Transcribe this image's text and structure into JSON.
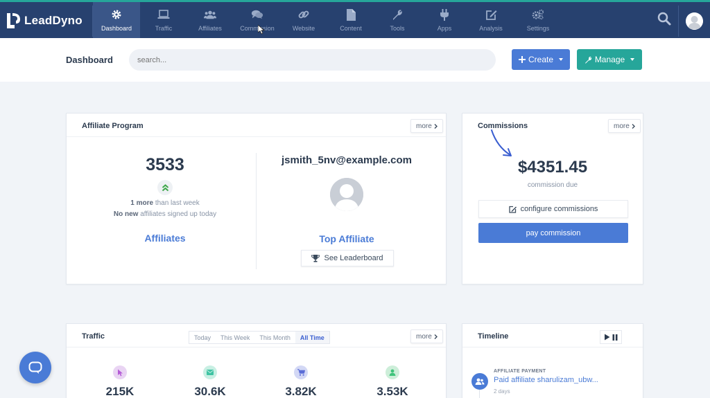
{
  "app": {
    "name": "LeadDyno"
  },
  "nav": {
    "items": [
      {
        "label": "Dashboard",
        "icon": "gear-icon",
        "active": true
      },
      {
        "label": "Traffic",
        "icon": "laptop-icon",
        "active": false
      },
      {
        "label": "Affiliates",
        "icon": "users-icon",
        "active": false
      },
      {
        "label": "Commission",
        "icon": "chat-bubbles-icon",
        "active": false
      },
      {
        "label": "Website",
        "icon": "link-icon",
        "active": false
      },
      {
        "label": "Content",
        "icon": "document-icon",
        "active": false
      },
      {
        "label": "Tools",
        "icon": "wrench-icon",
        "active": false
      },
      {
        "label": "Apps",
        "icon": "plug-icon",
        "active": false
      },
      {
        "label": "Analysis",
        "icon": "edit-square-icon",
        "active": false
      },
      {
        "label": "Settings",
        "icon": "gears-icon",
        "active": false
      }
    ]
  },
  "header": {
    "title": "Dashboard",
    "search_placeholder": "search...",
    "create_label": "Create",
    "manage_label": "Manage"
  },
  "affiliate_program": {
    "title": "Affiliate Program",
    "more_label": "more",
    "count": "3533",
    "more_count": "1 more",
    "more_suffix": "than last week",
    "new_count": "No new",
    "new_suffix": "affiliates signed up today",
    "link_label": "Affiliates",
    "top_email": "jsmith_5nv@example.com",
    "top_label": "Top Affiliate",
    "leaderboard_label": "See Leaderboard"
  },
  "commissions": {
    "title": "Commissions",
    "more_label": "more",
    "amount": "$4351.45",
    "amount_label": "commission due",
    "configure_label": "configure commissions",
    "pay_label": "pay commission"
  },
  "traffic": {
    "title": "Traffic",
    "more_label": "more",
    "ranges": [
      "Today",
      "This Week",
      "This Month",
      "All Time"
    ],
    "active_range": "All Time",
    "stats": [
      {
        "icon": "cursor-icon",
        "value": "215K",
        "color": "#c77ee0"
      },
      {
        "icon": "mail-icon",
        "value": "30.6K",
        "color": "#3fc3a3"
      },
      {
        "icon": "cart-icon",
        "value": "3.82K",
        "color": "#5b6dd6"
      },
      {
        "icon": "user-icon",
        "value": "3.53K",
        "color": "#3fc37b"
      }
    ]
  },
  "timeline": {
    "title": "Timeline",
    "items": [
      {
        "kicker": "AFFILIATE PAYMENT",
        "text": "Paid affiliate sharulizam_ubw...",
        "time": "2 days"
      }
    ]
  },
  "colors": {
    "nav_bg": "#27416f",
    "accent_blue": "#4a7bd6",
    "accent_teal": "#26a69a"
  }
}
